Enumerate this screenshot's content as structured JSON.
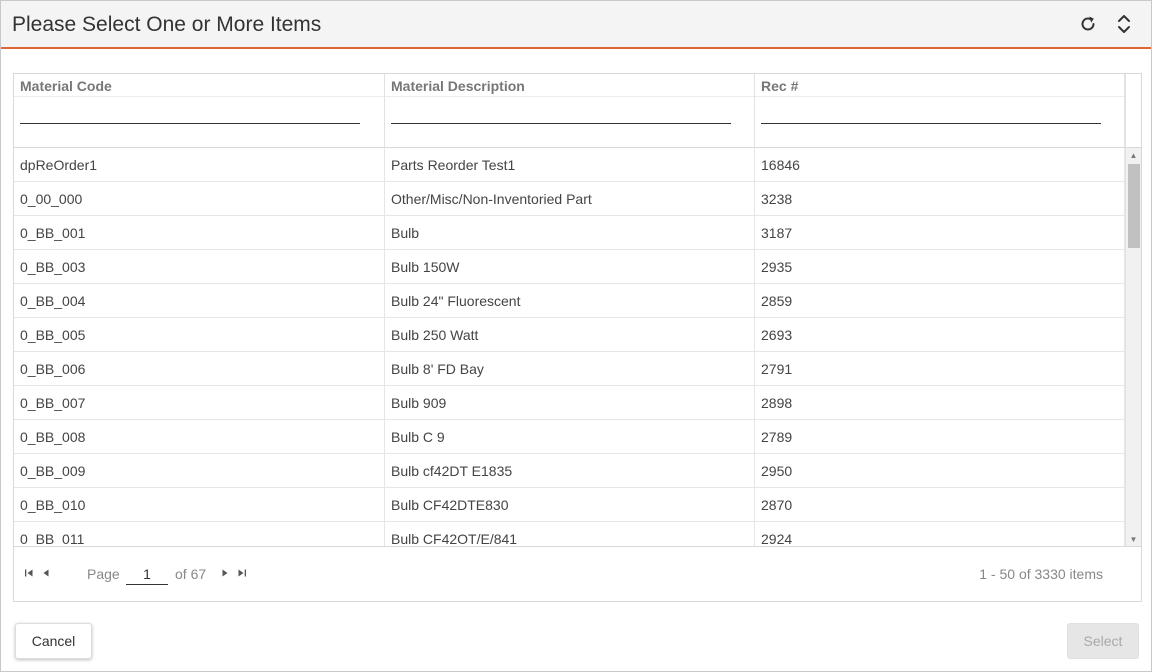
{
  "dialog": {
    "title": "Please Select One or More Items",
    "icons": {
      "refresh": "refresh-icon",
      "expand": "expand-collapse-icon"
    }
  },
  "grid": {
    "columns": [
      {
        "label": "Material Code",
        "filter_value": ""
      },
      {
        "label": "Material Description",
        "filter_value": ""
      },
      {
        "label": "Rec #",
        "filter_value": ""
      }
    ],
    "rows": [
      {
        "code": "dpReOrder1",
        "description": "Parts Reorder Test1",
        "rec": "16846"
      },
      {
        "code": "0_00_000",
        "description": "Other/Misc/Non-Inventoried Part",
        "rec": "3238"
      },
      {
        "code": "0_BB_001",
        "description": "Bulb",
        "rec": "3187"
      },
      {
        "code": "0_BB_003",
        "description": "Bulb 150W",
        "rec": "2935"
      },
      {
        "code": "0_BB_004",
        "description": "Bulb 24\" Fluorescent",
        "rec": "2859"
      },
      {
        "code": "0_BB_005",
        "description": "Bulb 250 Watt",
        "rec": "2693"
      },
      {
        "code": "0_BB_006",
        "description": "Bulb 8' FD Bay",
        "rec": "2791"
      },
      {
        "code": "0_BB_007",
        "description": "Bulb 909",
        "rec": "2898"
      },
      {
        "code": "0_BB_008",
        "description": "Bulb C 9",
        "rec": "2789"
      },
      {
        "code": "0_BB_009",
        "description": "Bulb cf42DT E1835",
        "rec": "2950"
      },
      {
        "code": "0_BB_010",
        "description": "Bulb CF42DTE830",
        "rec": "2870"
      },
      {
        "code": "0_BB_011",
        "description": "Bulb CF42OT/E/841",
        "rec": "2924"
      }
    ]
  },
  "pager": {
    "page_label": "Page",
    "page_value": "1",
    "of_label": "of 67",
    "info": "1 - 50 of 3330 items"
  },
  "buttons": {
    "cancel": "Cancel",
    "select": "Select"
  },
  "colors": {
    "accent": "#e0663a",
    "titlebar_bg": "#f4f4f4",
    "header_text": "#777777",
    "disabled_button_bg": "#e6e6e6"
  }
}
